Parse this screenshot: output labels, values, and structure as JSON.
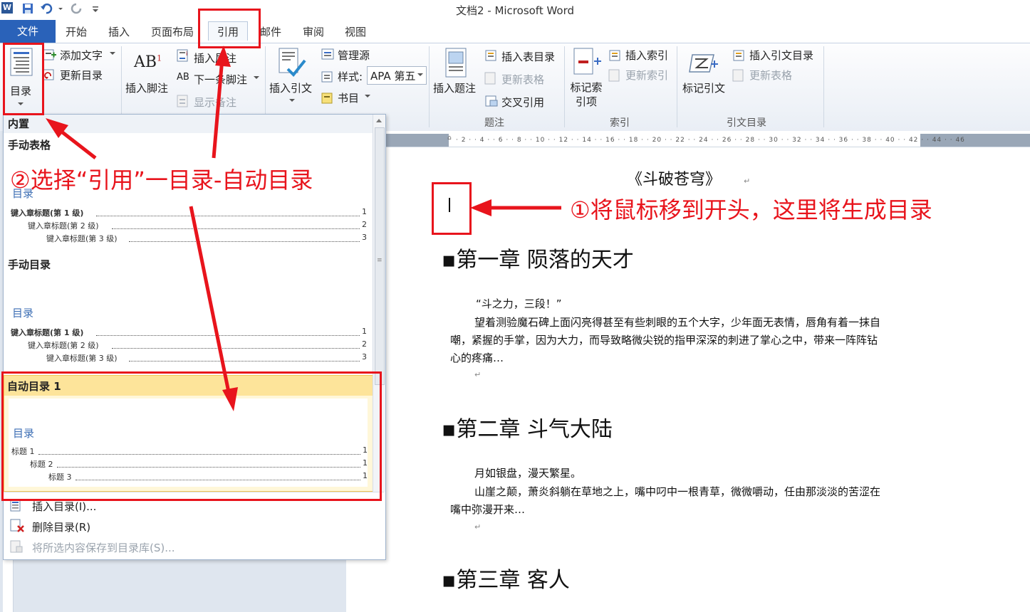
{
  "window": {
    "title": "文档2 - Microsoft Word",
    "app_icon": "W"
  },
  "tabs": {
    "file": "文件",
    "items": [
      "开始",
      "插入",
      "页面布局",
      "引用",
      "邮件",
      "审阅",
      "视图"
    ],
    "active": "引用"
  },
  "ribbon": {
    "toc_button": "目录",
    "add_text": "添加文字",
    "update_toc": "更新目录",
    "insert_footnote": "插入脚注",
    "insert_endnote": "插入尾注",
    "next_footnote": "下一条脚注",
    "show_notes": "显示备注",
    "insert_citation": "插入引文",
    "manage_sources": "管理源",
    "style_label": "样式:",
    "style_value": "APA 第五",
    "bibliography": "书目",
    "insert_caption": "插入题注",
    "insert_table_of_figures": "插入表目录",
    "update_table": "更新表格",
    "cross_reference": "交叉引用",
    "captions_group": "题注",
    "mark_entry": "标记索引项",
    "insert_index": "插入索引",
    "update_index": "更新索引",
    "index_group": "索引",
    "mark_citation": "标记引文",
    "insert_table_of_authorities": "插入引文目录",
    "update_table2": "更新表格",
    "authorities_group": "引文目录"
  },
  "dropdown": {
    "builtin_header": "内置",
    "manual_table": {
      "title": "手动表格",
      "heading": "目录",
      "lines": [
        {
          "label": "键入章标题(第 1 级)",
          "page": "1"
        },
        {
          "label": "键入章标题(第 2 级)",
          "page": "2"
        },
        {
          "label": "键入章标题(第 3 级)",
          "page": "3"
        }
      ]
    },
    "manual_toc": {
      "title": "手动目录",
      "heading": "目录",
      "lines": [
        {
          "label": "键入章标题(第 1 级)",
          "page": "1"
        },
        {
          "label": "键入章标题(第 2 级)",
          "page": "2"
        },
        {
          "label": "键入章标题(第 3 级)",
          "page": "3"
        }
      ]
    },
    "auto_toc": {
      "title": "自动目录 1",
      "heading": "目录",
      "lines": [
        {
          "label": "标题 1",
          "page": "1"
        },
        {
          "label": "标题 2",
          "page": "1"
        },
        {
          "label": "标题 3",
          "page": "1"
        }
      ]
    },
    "menu": {
      "insert_toc": "插入目录(I)...",
      "remove_toc": "删除目录(R)",
      "save_selection": "将所选内容保存到目录库(S)..."
    }
  },
  "document": {
    "title": "《斗破苍穹》",
    "chapter1": "第一章  陨落的天才",
    "ch1_p1": "“斗之力，三段！”",
    "ch1_p2a": "望着测验魔石碑上面闪亮得甚至有些刺眼的五个大字，少年面无表情，唇角有着一抹自",
    "ch1_p2b": "嘲，紧握的手掌，因为大力，而导致略微尖锐的指甲深深的刺进了掌心之中，带来一阵阵钻",
    "ch1_p2c": "心的疼痛…",
    "chapter2": "第二章  斗气大陆",
    "ch2_p1": "月如银盘，漫天繁星。",
    "ch2_p2a": "山崖之颠，萧炎斜躺在草地之上，嘴中叼中一根青草，微微嚼动，任由那淡淡的苦涩在",
    "ch2_p2b": "嘴中弥漫开来…",
    "chapter3": "第三章  客人"
  },
  "annotations": {
    "step1": "①将鼠标移到开头，这里将生成目录",
    "step2": "②选择“引用”一目录-自动目录"
  },
  "colors": {
    "accent": "#2a62b9",
    "annotation": "#e8141c",
    "toc_heading": "#3c6eb4",
    "highlight": "#fff7d9"
  }
}
